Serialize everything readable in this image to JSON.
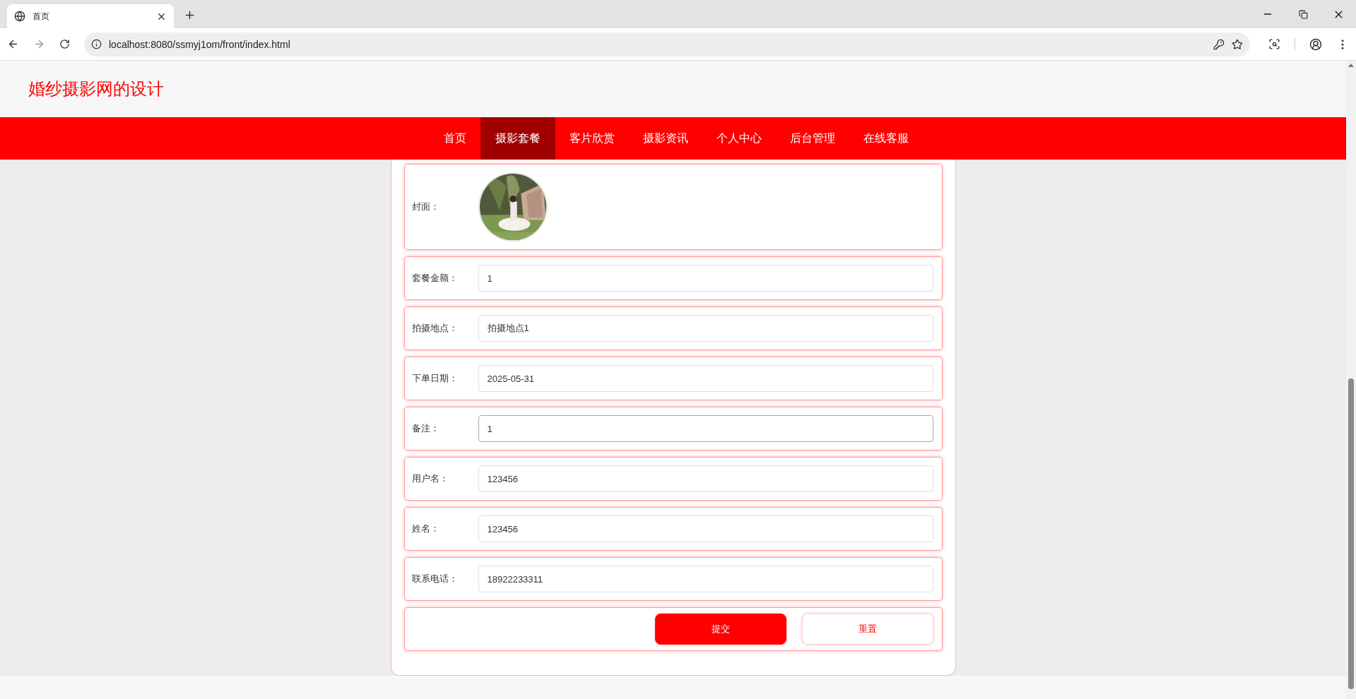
{
  "browser": {
    "tab_title": "首页",
    "url": "localhost:8080/ssmyj1om/front/index.html"
  },
  "site": {
    "title": "婚纱摄影网的设计"
  },
  "nav": [
    {
      "label": "首页",
      "selected": false
    },
    {
      "label": "摄影套餐",
      "selected": true
    },
    {
      "label": "客片欣赏",
      "selected": false
    },
    {
      "label": "摄影资讯",
      "selected": false
    },
    {
      "label": "个人中心",
      "selected": false
    },
    {
      "label": "后台管理",
      "selected": false
    },
    {
      "label": "在线客服",
      "selected": false
    }
  ],
  "form": {
    "cover": {
      "label": "封面：",
      "kind": "picture"
    },
    "fields": [
      {
        "label": "套餐金额：",
        "value": "1",
        "focused": false
      },
      {
        "label": "拍摄地点：",
        "value": "拍摄地点1",
        "focused": false
      },
      {
        "label": "下单日期：",
        "value": "2025-05-31",
        "focused": false
      },
      {
        "label": "备注：",
        "value": "1",
        "focused": true
      },
      {
        "label": "用户名：",
        "value": "123456",
        "focused": false
      },
      {
        "label": "姓名：",
        "value": "123456",
        "focused": false
      },
      {
        "label": "联系电话：",
        "value": "18922233311",
        "focused": false
      }
    ],
    "buttons": [
      {
        "label": "提交",
        "kind": "primary"
      },
      {
        "label": "重置",
        "kind": "secondary"
      }
    ]
  }
}
